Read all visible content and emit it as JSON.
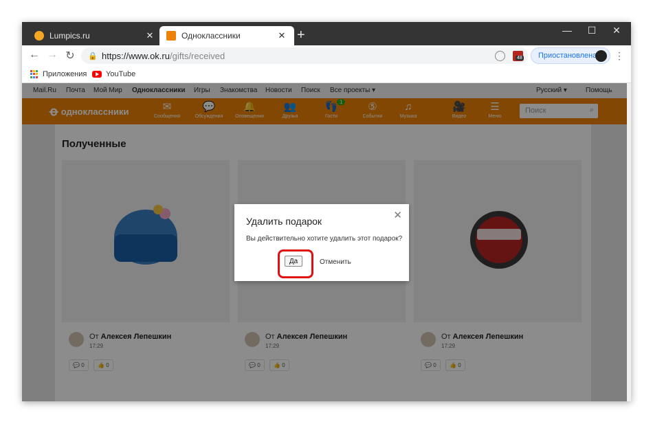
{
  "browser": {
    "tabs": [
      {
        "title": "Lumpics.ru",
        "favicon_color": "#f5a623",
        "active": false
      },
      {
        "title": "Одноклассники",
        "favicon_color": "#ee8208",
        "active": true
      }
    ],
    "close_glyph": "✕",
    "new_tab_glyph": "+",
    "window_controls": {
      "minimize": "—",
      "maximize": "☐",
      "close": "✕"
    },
    "url": {
      "host": "https://www.ok.ru",
      "path": "/gifts/received"
    },
    "profile_label": "Приостановлена",
    "extension_badge": "48",
    "bookmarks": [
      {
        "label": "Приложения",
        "icon": "apps-grid-icon"
      },
      {
        "label": "YouTube",
        "icon": "youtube-icon"
      }
    ]
  },
  "portal_bar": {
    "items": [
      "Mail.Ru",
      "Почта",
      "Мой Мир",
      "Одноклассники",
      "Игры",
      "Знакомства",
      "Новости",
      "Поиск",
      "Все проекты ▾"
    ],
    "language": "Русский ▾",
    "help": "Помощь"
  },
  "ok_header": {
    "logo": "одноклассники",
    "nav": [
      {
        "label": "Сообщения",
        "icon": "envelope-icon",
        "glyph": "✉"
      },
      {
        "label": "Обсуждения",
        "icon": "chat-icon",
        "glyph": "💬"
      },
      {
        "label": "Оповещения",
        "icon": "bell-icon",
        "glyph": "🔔"
      },
      {
        "label": "Друзья",
        "icon": "friends-icon",
        "glyph": "👥"
      },
      {
        "label": "Гости",
        "icon": "footprints-icon",
        "glyph": "👣",
        "badge": "1"
      },
      {
        "label": "События",
        "icon": "events-icon",
        "glyph": "⑤"
      },
      {
        "label": "Музыка",
        "icon": "music-icon",
        "glyph": "♫"
      },
      {
        "label": "Видео",
        "icon": "video-icon",
        "glyph": "🎥"
      },
      {
        "label": "Меню",
        "icon": "menu-icon",
        "glyph": "☰"
      }
    ],
    "search_placeholder": "Поиск"
  },
  "main": {
    "title": "Полученные",
    "gifts": [
      {
        "from_prefix": "От",
        "from_name": "Алексея Лепешкин",
        "time": "17:29",
        "comments": "0",
        "likes": "0"
      },
      {
        "from_prefix": "От",
        "from_name": "Алексея Лепешкин",
        "time": "17:29",
        "comments": "0",
        "likes": "0"
      },
      {
        "from_prefix": "От",
        "from_name": "Алексея Лепешкин",
        "time": "17:29",
        "comments": "0",
        "likes": "0"
      }
    ]
  },
  "dialog": {
    "title": "Удалить подарок",
    "message": "Вы действительно хотите удалить этот подарок?",
    "confirm": "Да",
    "cancel": "Отменить",
    "highlight_color": "#e01111"
  }
}
